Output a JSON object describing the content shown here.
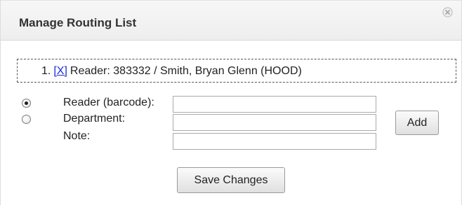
{
  "dialog": {
    "title": "Manage Routing List"
  },
  "routing_list": {
    "items": [
      {
        "number": "1.",
        "remove_label": "[X]",
        "description": "Reader: 383332 / Smith, Bryan Glenn (HOOD)"
      }
    ]
  },
  "form": {
    "reader_label": "Reader (barcode):",
    "department_label": "Department:",
    "note_label": "Note:",
    "reader_value": "",
    "department_value": "",
    "note_value": "",
    "selected_option": "reader"
  },
  "buttons": {
    "add_label": "Add",
    "save_label": "Save Changes"
  },
  "icons": {
    "close": "close-icon"
  },
  "colors": {
    "link": "#1a2fd4"
  }
}
